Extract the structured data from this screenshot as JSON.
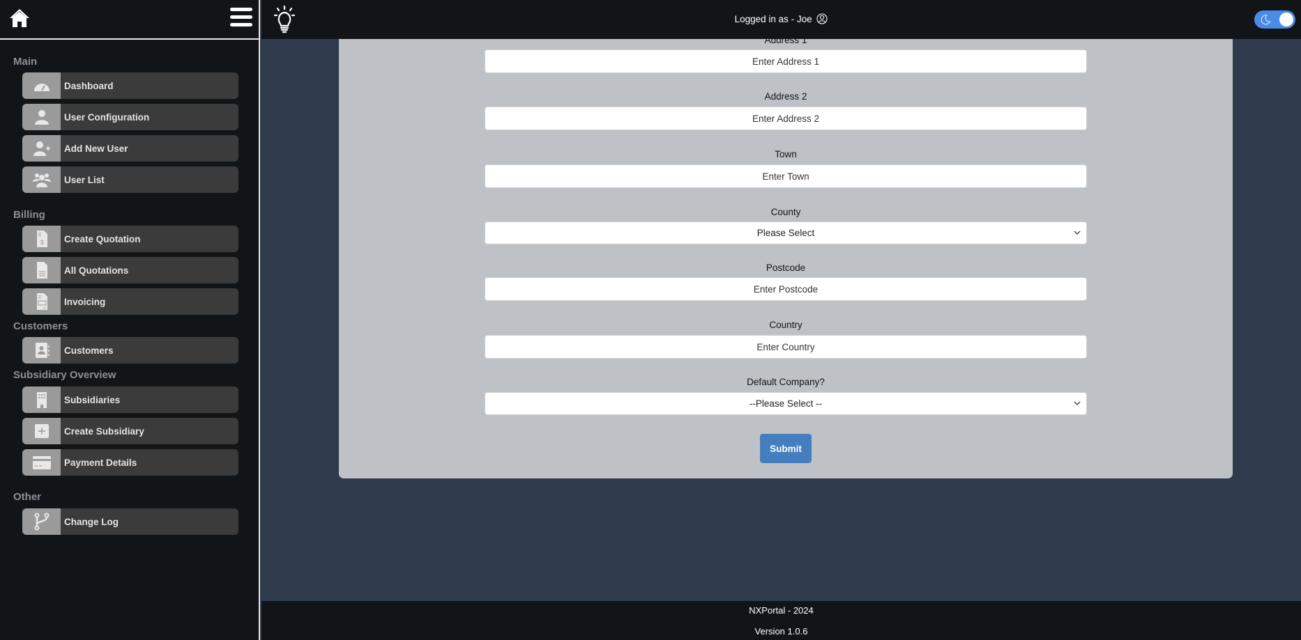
{
  "header": {
    "logged_in_text": "Logged in as - Joe",
    "theme_toggle": {
      "mode": "dark",
      "on": true,
      "accent": "#4a8be6"
    }
  },
  "sidebar": {
    "sections": [
      {
        "title": "Main",
        "items": [
          {
            "label": "Dashboard",
            "icon": "gauge-icon"
          },
          {
            "label": "User Configuration",
            "icon": "user-icon"
          },
          {
            "label": "Add New User",
            "icon": "user-plus-icon"
          },
          {
            "label": "User List",
            "icon": "users-icon"
          }
        ]
      },
      {
        "title": "Billing",
        "items": [
          {
            "label": "Create Quotation",
            "icon": "invoice-dollar-icon"
          },
          {
            "label": "All Quotations",
            "icon": "file-lines-icon"
          },
          {
            "label": "Invoicing",
            "icon": "invoice-icon"
          }
        ]
      },
      {
        "title": "Customers",
        "items": [
          {
            "label": "Customers",
            "icon": "address-book-icon"
          }
        ]
      },
      {
        "title": "Subsidiary Overview",
        "items": [
          {
            "label": "Subsidiaries",
            "icon": "building-icon"
          },
          {
            "label": "Create Subsidiary",
            "icon": "plus-square-icon"
          },
          {
            "label": "Payment Details",
            "icon": "credit-card-icon"
          }
        ]
      },
      {
        "title": "Other",
        "items": [
          {
            "label": "Change Log",
            "icon": "code-branch-icon"
          }
        ]
      }
    ]
  },
  "form": {
    "fields": [
      {
        "label": "Address 1",
        "type": "input",
        "placeholder": "Enter Address 1",
        "value": ""
      },
      {
        "label": "Address 2",
        "type": "input",
        "placeholder": "Enter Address 2",
        "value": ""
      },
      {
        "label": "Town",
        "type": "input",
        "placeholder": "Enter Town",
        "value": ""
      },
      {
        "label": "County",
        "type": "select",
        "selected": "Please Select"
      },
      {
        "label": "Postcode",
        "type": "input",
        "placeholder": "Enter Postcode",
        "value": ""
      },
      {
        "label": "Country",
        "type": "input",
        "placeholder": "Enter Country",
        "value": ""
      },
      {
        "label": "Default Company?",
        "type": "select",
        "selected": "--Please Select --"
      }
    ],
    "submit_label": "Submit"
  },
  "footer": {
    "line1": "NXPortal - 2024",
    "line2": "Version 1.0.6"
  }
}
